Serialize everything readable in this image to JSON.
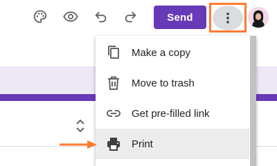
{
  "toolbar": {
    "icons": {
      "palette": "palette-icon",
      "preview": "eye-icon",
      "undo": "undo-icon",
      "redo": "redo-icon",
      "more": "more-vert-icon"
    },
    "send_label": "Send"
  },
  "menu": {
    "items": [
      {
        "label": "Make a copy",
        "icon": "copy-icon"
      },
      {
        "label": "Move to trash",
        "icon": "trash-icon"
      },
      {
        "label": "Get pre-filled link",
        "icon": "link-icon"
      },
      {
        "label": "Print",
        "icon": "print-icon"
      }
    ],
    "highlighted": "Print"
  },
  "colors": {
    "accent": "#673ab7",
    "highlight_border": "#ff7a2f",
    "menu_hover": "#ececec",
    "header_band": "#ede7f6"
  }
}
